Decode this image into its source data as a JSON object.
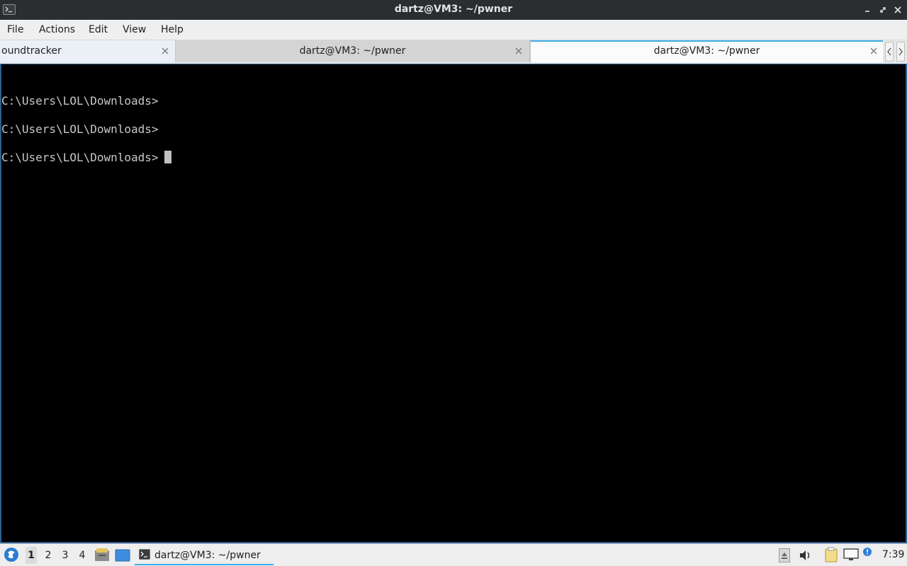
{
  "window": {
    "title": "dartz@VM3: ~/pwner"
  },
  "menu": {
    "file": "File",
    "actions": "Actions",
    "edit": "Edit",
    "view": "View",
    "help": "Help"
  },
  "tabs": [
    {
      "label": "oundtracker",
      "active": false
    },
    {
      "label": "dartz@VM3: ~/pwner",
      "active": false
    },
    {
      "label": "dartz@VM3: ~/pwner",
      "active": true
    }
  ],
  "terminal": {
    "lines": [
      "C:\\Users\\LOL\\Downloads>",
      "C:\\Users\\LOL\\Downloads>",
      "C:\\Users\\LOL\\Downloads>"
    ]
  },
  "taskbar": {
    "workspaces": [
      "1",
      "2",
      "3",
      "4"
    ],
    "active_workspace": "1",
    "task_label": "dartz@VM3: ~/pwner",
    "clock": "7:39"
  },
  "colors": {
    "accent": "#3daee9",
    "terminal_bg": "#000000",
    "terminal_fg": "#c8c8c8",
    "titlebar_bg": "#2b2e31"
  },
  "icons": {
    "start": "start-menu-icon",
    "file_manager": "file-manager-icon",
    "show_desktop": "show-desktop-icon",
    "terminal": "terminal-icon",
    "eject": "eject-icon",
    "volume": "volume-icon",
    "clipboard": "clipboard-icon",
    "network": "network-icon",
    "notification": "notification-icon"
  }
}
